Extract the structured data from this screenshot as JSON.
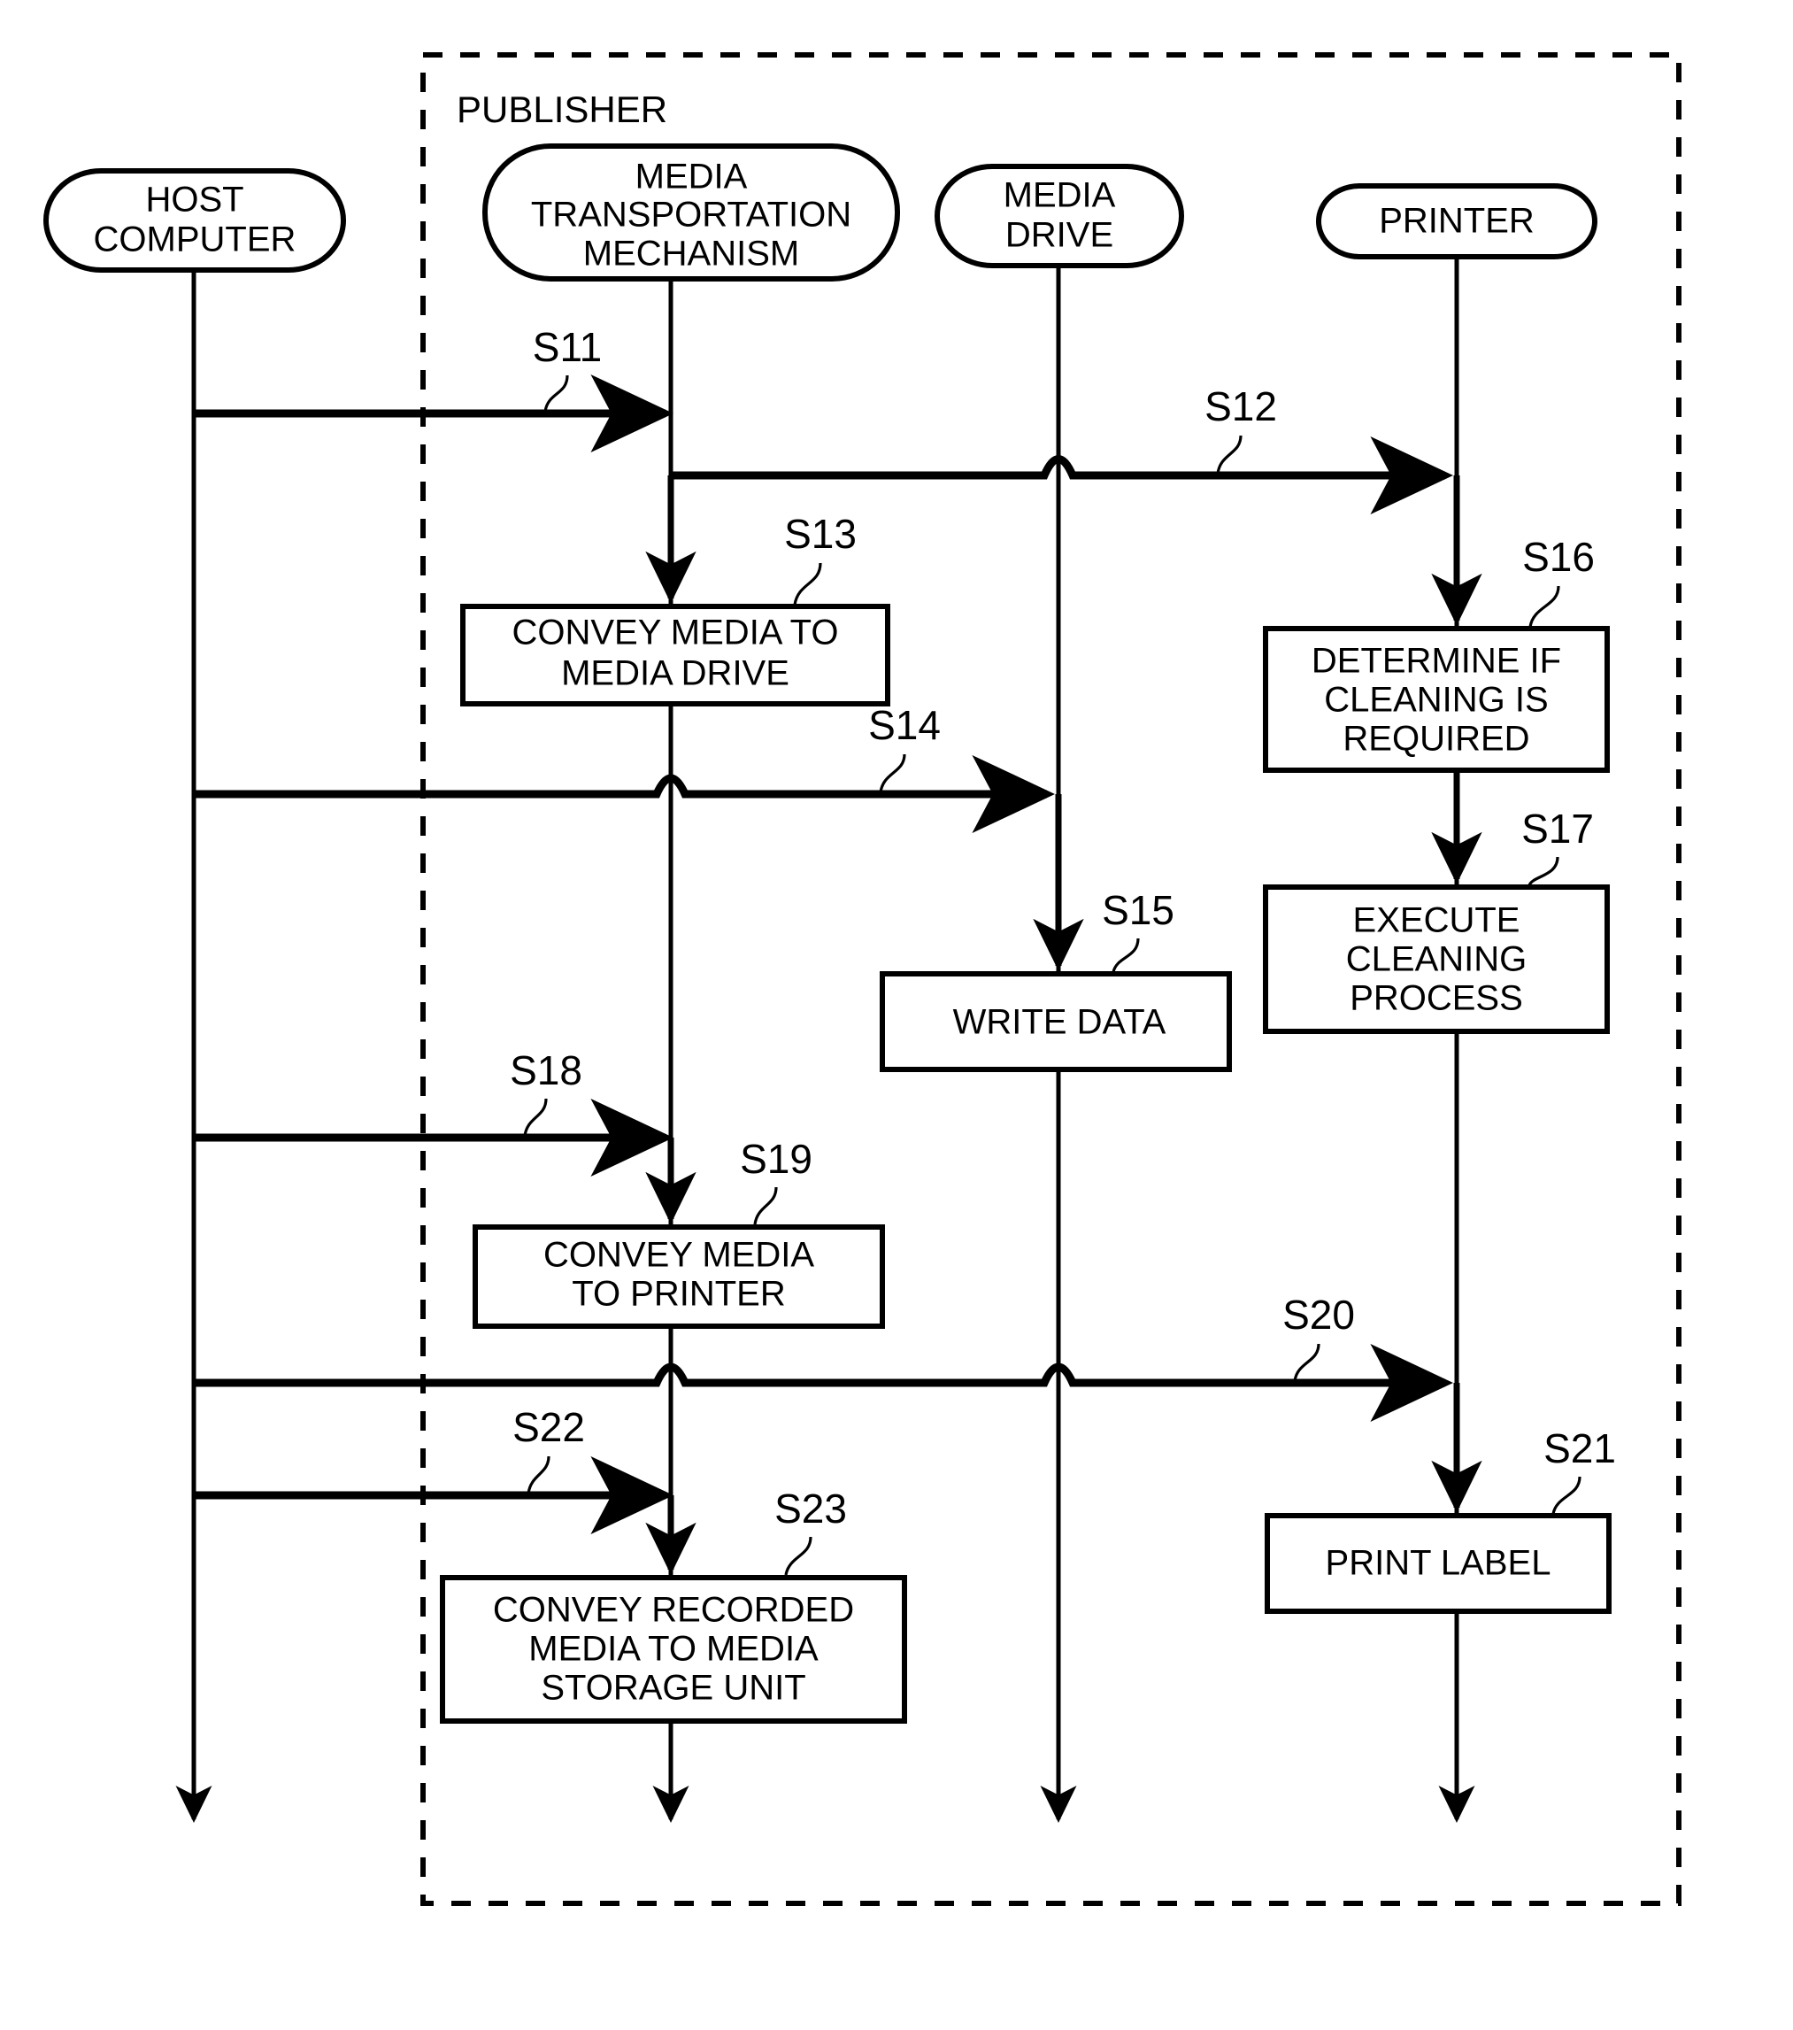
{
  "figure": {
    "type": "sequence-diagram",
    "group": {
      "label": "PUBLISHER"
    },
    "lifelines": [
      {
        "id": "host",
        "label_line1": "HOST",
        "label_line2": "COMPUTER",
        "label_line3": "",
        "inside_group": false
      },
      {
        "id": "mtm",
        "label_line1": "MEDIA",
        "label_line2": "TRANSPORTATION",
        "label_line3": "MECHANISM",
        "inside_group": true
      },
      {
        "id": "drive",
        "label_line1": "MEDIA",
        "label_line2": "DRIVE",
        "label_line3": "",
        "inside_group": true
      },
      {
        "id": "printer",
        "label_line1": "PRINTER",
        "label_line2": "",
        "label_line3": "",
        "inside_group": true
      }
    ],
    "messages": [
      {
        "step": "S11",
        "from": "host",
        "to": "mtm",
        "hops": []
      },
      {
        "step": "S12",
        "from": "mtm",
        "to": "printer",
        "hops": [
          "drive"
        ]
      },
      {
        "step": "S14",
        "from": "host",
        "to": "drive",
        "hops": [
          "mtm"
        ]
      },
      {
        "step": "S18",
        "from": "host",
        "to": "mtm",
        "hops": []
      },
      {
        "step": "S20",
        "from": "host",
        "to": "printer",
        "hops": [
          "mtm",
          "drive"
        ]
      },
      {
        "step": "S22",
        "from": "host",
        "to": "mtm",
        "hops": []
      }
    ],
    "process_boxes": [
      {
        "step": "S13",
        "lane": "mtm",
        "line1": "CONVEY MEDIA TO",
        "line2": "MEDIA DRIVE",
        "line3": ""
      },
      {
        "step": "S16",
        "lane": "printer",
        "line1": "DETERMINE IF",
        "line2": "CLEANING IS",
        "line3": "REQUIRED"
      },
      {
        "step": "S17",
        "lane": "printer",
        "line1": "EXECUTE",
        "line2": "CLEANING",
        "line3": "PROCESS"
      },
      {
        "step": "S15",
        "lane": "drive",
        "line1": "WRITE DATA",
        "line2": "",
        "line3": ""
      },
      {
        "step": "S19",
        "lane": "mtm",
        "line1": "CONVEY MEDIA",
        "line2": "TO PRINTER",
        "line3": ""
      },
      {
        "step": "S21",
        "lane": "printer",
        "line1": "PRINT LABEL",
        "line2": "",
        "line3": ""
      },
      {
        "step": "S23",
        "lane": "mtm",
        "line1": "CONVEY RECORDED",
        "line2": "MEDIA TO MEDIA",
        "line3": "STORAGE UNIT"
      }
    ],
    "step_labels": [
      "S11",
      "S12",
      "S13",
      "S14",
      "S15",
      "S16",
      "S17",
      "S18",
      "S19",
      "S20",
      "S21",
      "S22",
      "S23"
    ],
    "colors": {
      "ink": "#000000",
      "paper": "#ffffff"
    }
  }
}
